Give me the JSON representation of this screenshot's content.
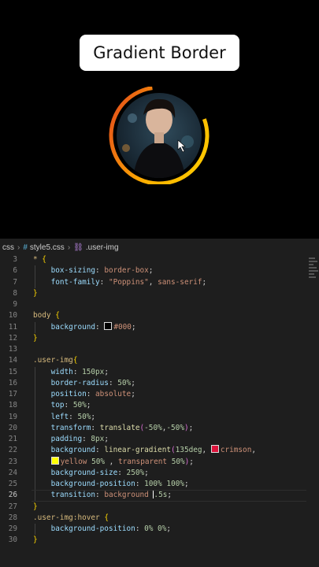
{
  "preview": {
    "title": "Gradient Border",
    "ring_colors": {
      "start": "#ffd000",
      "end": "#e0401e"
    }
  },
  "breadcrumb": {
    "root": "css",
    "file": "style5.css",
    "symbol": ".user-img"
  },
  "colors": {
    "swatch_black": "#000000",
    "swatch_crimson": "#dc143c",
    "swatch_yellow": "#ffff00"
  },
  "code": {
    "active_line": 26,
    "lines": [
      {
        "n": "3",
        "tokens": [
          {
            "t": "* ",
            "c": "tk-sel"
          },
          {
            "t": "{",
            "c": "tk-brace"
          }
        ]
      },
      {
        "n": "6",
        "tokens": [
          {
            "t": "    "
          },
          {
            "t": "box-sizing",
            "c": "tk-prop"
          },
          {
            "t": ": ",
            "c": "tk-pun"
          },
          {
            "t": "border-box",
            "c": "tk-val"
          },
          {
            "t": ";",
            "c": "tk-pun"
          }
        ]
      },
      {
        "n": "7",
        "tokens": [
          {
            "t": "    "
          },
          {
            "t": "font-family",
            "c": "tk-prop"
          },
          {
            "t": ": ",
            "c": "tk-pun"
          },
          {
            "t": "\"Poppins\"",
            "c": "tk-val"
          },
          {
            "t": ", ",
            "c": "tk-pun"
          },
          {
            "t": "sans-serif",
            "c": "tk-val"
          },
          {
            "t": ";",
            "c": "tk-pun"
          }
        ]
      },
      {
        "n": "8",
        "tokens": [
          {
            "t": "}",
            "c": "tk-brace"
          }
        ]
      },
      {
        "n": "9",
        "tokens": []
      },
      {
        "n": "10",
        "tokens": [
          {
            "t": "body ",
            "c": "tk-sel"
          },
          {
            "t": "{",
            "c": "tk-brace"
          }
        ]
      },
      {
        "n": "11",
        "tokens": [
          {
            "t": "    "
          },
          {
            "t": "background",
            "c": "tk-prop"
          },
          {
            "t": ": ",
            "c": "tk-pun"
          },
          {
            "swatch": "swatch_black"
          },
          {
            "t": "#000",
            "c": "tk-val"
          },
          {
            "t": ";",
            "c": "tk-pun"
          }
        ]
      },
      {
        "n": "12",
        "tokens": [
          {
            "t": "}",
            "c": "tk-brace"
          }
        ]
      },
      {
        "n": "13",
        "tokens": []
      },
      {
        "n": "14",
        "tokens": [
          {
            "t": ".user-img",
            "c": "tk-sel"
          },
          {
            "t": "{",
            "c": "tk-brace"
          }
        ]
      },
      {
        "n": "15",
        "tokens": [
          {
            "t": "    "
          },
          {
            "t": "width",
            "c": "tk-prop"
          },
          {
            "t": ": ",
            "c": "tk-pun"
          },
          {
            "t": "150px",
            "c": "tk-num"
          },
          {
            "t": ";",
            "c": "tk-pun"
          }
        ]
      },
      {
        "n": "16",
        "tokens": [
          {
            "t": "    "
          },
          {
            "t": "border-radius",
            "c": "tk-prop"
          },
          {
            "t": ": ",
            "c": "tk-pun"
          },
          {
            "t": "50%",
            "c": "tk-num"
          },
          {
            "t": ";",
            "c": "tk-pun"
          }
        ]
      },
      {
        "n": "17",
        "tokens": [
          {
            "t": "    "
          },
          {
            "t": "position",
            "c": "tk-prop"
          },
          {
            "t": ": ",
            "c": "tk-pun"
          },
          {
            "t": "absolute",
            "c": "tk-val"
          },
          {
            "t": ";",
            "c": "tk-pun"
          }
        ]
      },
      {
        "n": "18",
        "tokens": [
          {
            "t": "    "
          },
          {
            "t": "top",
            "c": "tk-prop"
          },
          {
            "t": ": ",
            "c": "tk-pun"
          },
          {
            "t": "50%",
            "c": "tk-num"
          },
          {
            "t": ";",
            "c": "tk-pun"
          }
        ]
      },
      {
        "n": "19",
        "tokens": [
          {
            "t": "    "
          },
          {
            "t": "left",
            "c": "tk-prop"
          },
          {
            "t": ": ",
            "c": "tk-pun"
          },
          {
            "t": "50%",
            "c": "tk-num"
          },
          {
            "t": ";",
            "c": "tk-pun"
          }
        ]
      },
      {
        "n": "20",
        "tokens": [
          {
            "t": "    "
          },
          {
            "t": "transform",
            "c": "tk-prop"
          },
          {
            "t": ": ",
            "c": "tk-pun"
          },
          {
            "t": "translate",
            "c": "tk-fn"
          },
          {
            "t": "(",
            "c": "tk-bra2"
          },
          {
            "t": "-50%",
            "c": "tk-num"
          },
          {
            "t": ",",
            "c": "tk-pun"
          },
          {
            "t": "-50%",
            "c": "tk-num"
          },
          {
            "t": ")",
            "c": "tk-bra2"
          },
          {
            "t": ";",
            "c": "tk-pun"
          }
        ]
      },
      {
        "n": "21",
        "tokens": [
          {
            "t": "    "
          },
          {
            "t": "padding",
            "c": "tk-prop"
          },
          {
            "t": ": ",
            "c": "tk-pun"
          },
          {
            "t": "8px",
            "c": "tk-num"
          },
          {
            "t": ";",
            "c": "tk-pun"
          }
        ]
      },
      {
        "n": "22",
        "tokens": [
          {
            "t": "    "
          },
          {
            "t": "background",
            "c": "tk-prop"
          },
          {
            "t": ": ",
            "c": "tk-pun"
          },
          {
            "t": "linear-gradient",
            "c": "tk-fn"
          },
          {
            "t": "(",
            "c": "tk-bra2"
          },
          {
            "t": "135deg",
            "c": "tk-num"
          },
          {
            "t": ", ",
            "c": "tk-pun"
          },
          {
            "swatch": "swatch_crimson"
          },
          {
            "t": "crimson",
            "c": "tk-val"
          },
          {
            "t": ",",
            "c": "tk-pun"
          }
        ]
      },
      {
        "n": "23",
        "tokens": [
          {
            "t": "    "
          },
          {
            "swatch": "swatch_yellow"
          },
          {
            "t": "yellow ",
            "c": "tk-val"
          },
          {
            "t": "50%",
            "c": "tk-num"
          },
          {
            "t": " , ",
            "c": "tk-pun"
          },
          {
            "t": "transparent ",
            "c": "tk-val"
          },
          {
            "t": "50%",
            "c": "tk-num"
          },
          {
            "t": ")",
            "c": "tk-bra2"
          },
          {
            "t": ";",
            "c": "tk-pun"
          }
        ]
      },
      {
        "n": "24",
        "tokens": [
          {
            "t": "    "
          },
          {
            "t": "background-size",
            "c": "tk-prop"
          },
          {
            "t": ": ",
            "c": "tk-pun"
          },
          {
            "t": "250%",
            "c": "tk-num"
          },
          {
            "t": ";",
            "c": "tk-pun"
          }
        ]
      },
      {
        "n": "25",
        "tokens": [
          {
            "t": "    "
          },
          {
            "t": "background-position",
            "c": "tk-prop"
          },
          {
            "t": ": ",
            "c": "tk-pun"
          },
          {
            "t": "100% 100%",
            "c": "tk-num"
          },
          {
            "t": ";",
            "c": "tk-pun"
          }
        ]
      },
      {
        "n": "26",
        "tokens": [
          {
            "t": "    "
          },
          {
            "t": "transition",
            "c": "tk-prop"
          },
          {
            "t": ": ",
            "c": "tk-pun"
          },
          {
            "t": "background ",
            "c": "tk-val"
          },
          {
            "caret": true
          },
          {
            "t": ".5s",
            "c": "tk-num"
          },
          {
            "t": ";",
            "c": "tk-pun"
          }
        ]
      },
      {
        "n": "27",
        "tokens": [
          {
            "t": "}",
            "c": "tk-brace"
          }
        ]
      },
      {
        "n": "28",
        "tokens": [
          {
            "t": ".user-img:hover ",
            "c": "tk-sel"
          },
          {
            "t": "{",
            "c": "tk-brace"
          }
        ]
      },
      {
        "n": "29",
        "tokens": [
          {
            "t": "    "
          },
          {
            "t": "background-position",
            "c": "tk-prop"
          },
          {
            "t": ": ",
            "c": "tk-pun"
          },
          {
            "t": "0% 0%",
            "c": "tk-num"
          },
          {
            "t": ";",
            "c": "tk-pun"
          }
        ]
      },
      {
        "n": "30",
        "tokens": [
          {
            "t": "}",
            "c": "tk-brace"
          }
        ]
      }
    ]
  }
}
